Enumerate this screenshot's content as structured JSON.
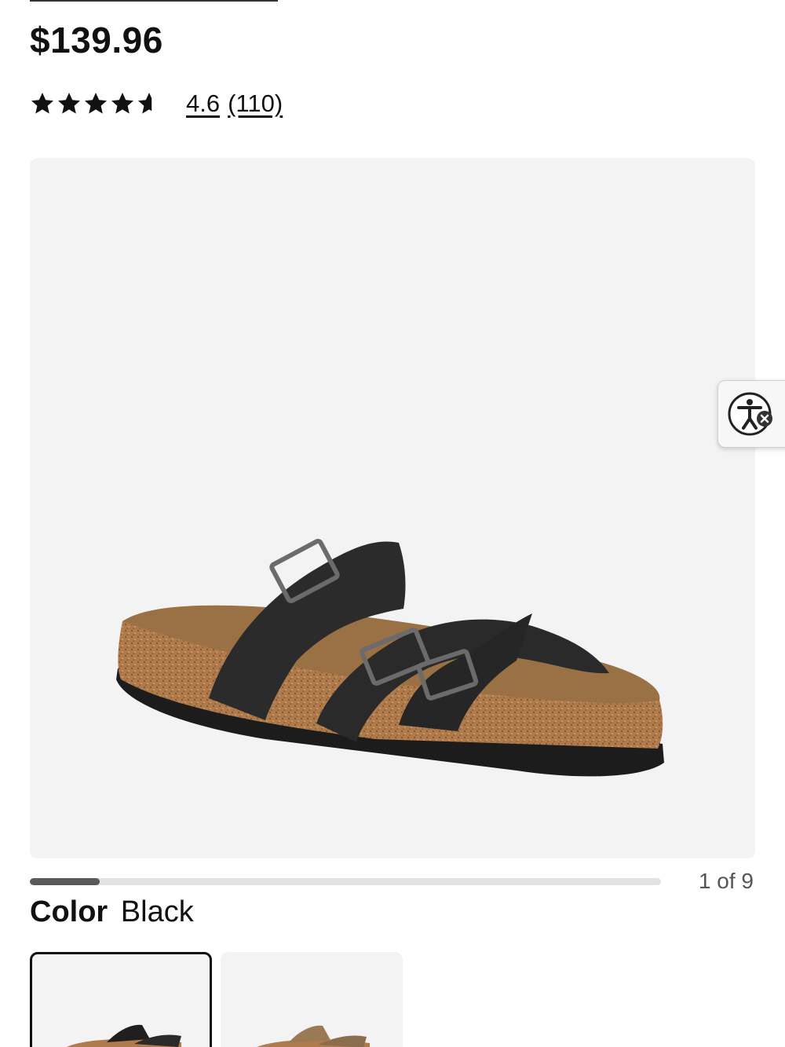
{
  "product": {
    "price": "$139.96",
    "rating": {
      "value_text": "4.6",
      "count_text": "(110)",
      "stars": 4.6,
      "max_stars": 5
    }
  },
  "gallery": {
    "counter": "1 of 9",
    "progress": 0.111,
    "image_icon": "sandal-product-image"
  },
  "color": {
    "label": "Color",
    "value": "Black",
    "swatches": [
      {
        "name": "Black",
        "selected": true
      },
      {
        "name": "Tan",
        "selected": false
      }
    ]
  },
  "accessibility": {
    "icon": "accessibility-icon"
  },
  "colors": {
    "text": "#111111",
    "image_background": "#f3f3f3",
    "progress_fill": "#5a5a5a",
    "progress_track": "#e2e2e2"
  }
}
